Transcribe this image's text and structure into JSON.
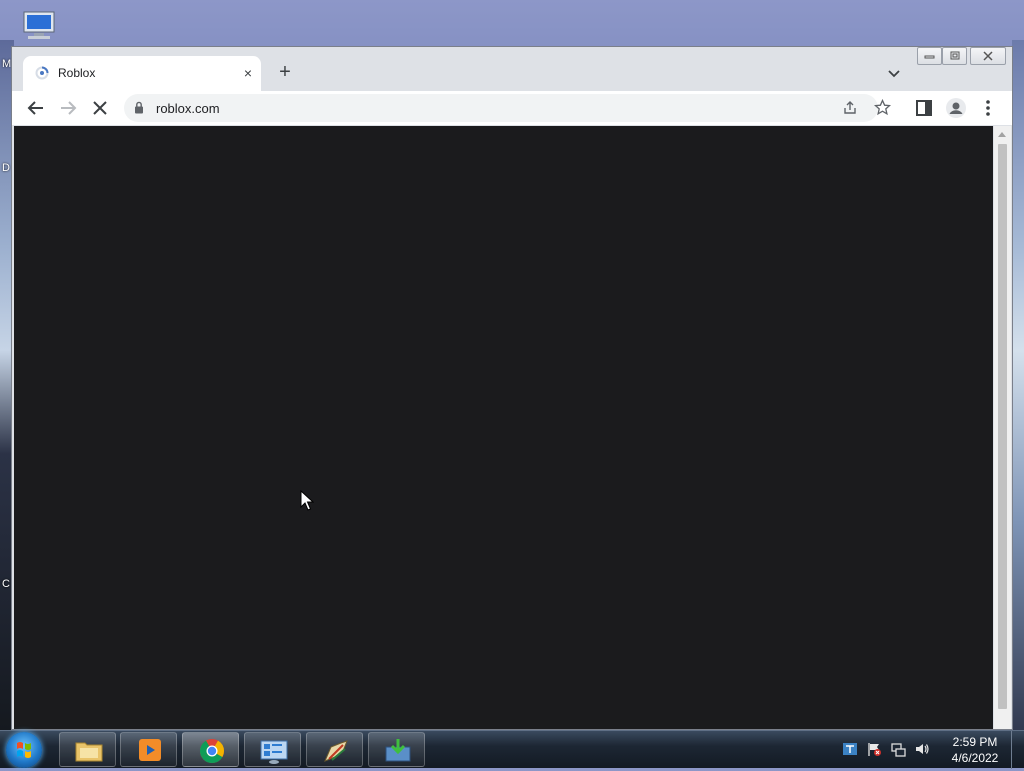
{
  "desktop": {
    "edge_letters": [
      "M",
      "D",
      "C"
    ]
  },
  "browser": {
    "tab": {
      "title": "Roblox",
      "close_glyph": "×"
    },
    "new_tab_glyph": "+",
    "address_bar": {
      "url": "roblox.com"
    },
    "page_background": "#1b1b1d",
    "loading": true
  },
  "taskbar": {
    "apps": [
      "windows-explorer",
      "media-player",
      "google-chrome",
      "control-panel",
      "paint-tool",
      "download-manager"
    ],
    "active_app": "google-chrome",
    "clock": {
      "time": "2:59 PM",
      "date": "4/6/2022"
    }
  }
}
